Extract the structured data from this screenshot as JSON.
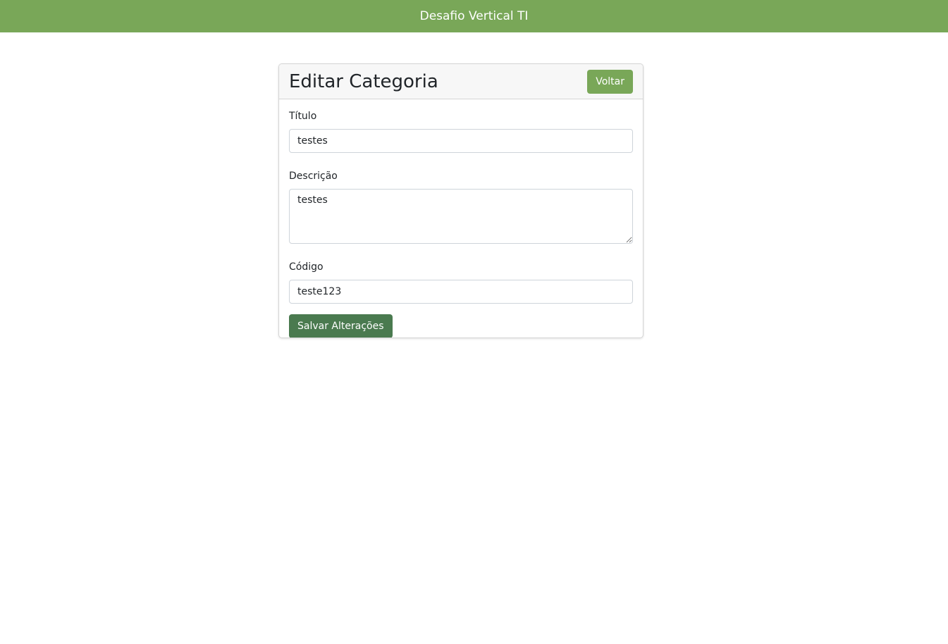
{
  "header": {
    "title": "Desafio Vertical TI"
  },
  "card": {
    "title": "Editar Categoria",
    "back_label": "Voltar"
  },
  "form": {
    "titulo": {
      "label": "Título",
      "value": "testes"
    },
    "descricao": {
      "label": "Descrição",
      "value": "testes"
    },
    "codigo": {
      "label": "Código",
      "value": "teste123"
    },
    "save_label": "Salvar Alterações"
  },
  "colors": {
    "brand": "#79a758",
    "save_button": "#4a7a4f"
  }
}
